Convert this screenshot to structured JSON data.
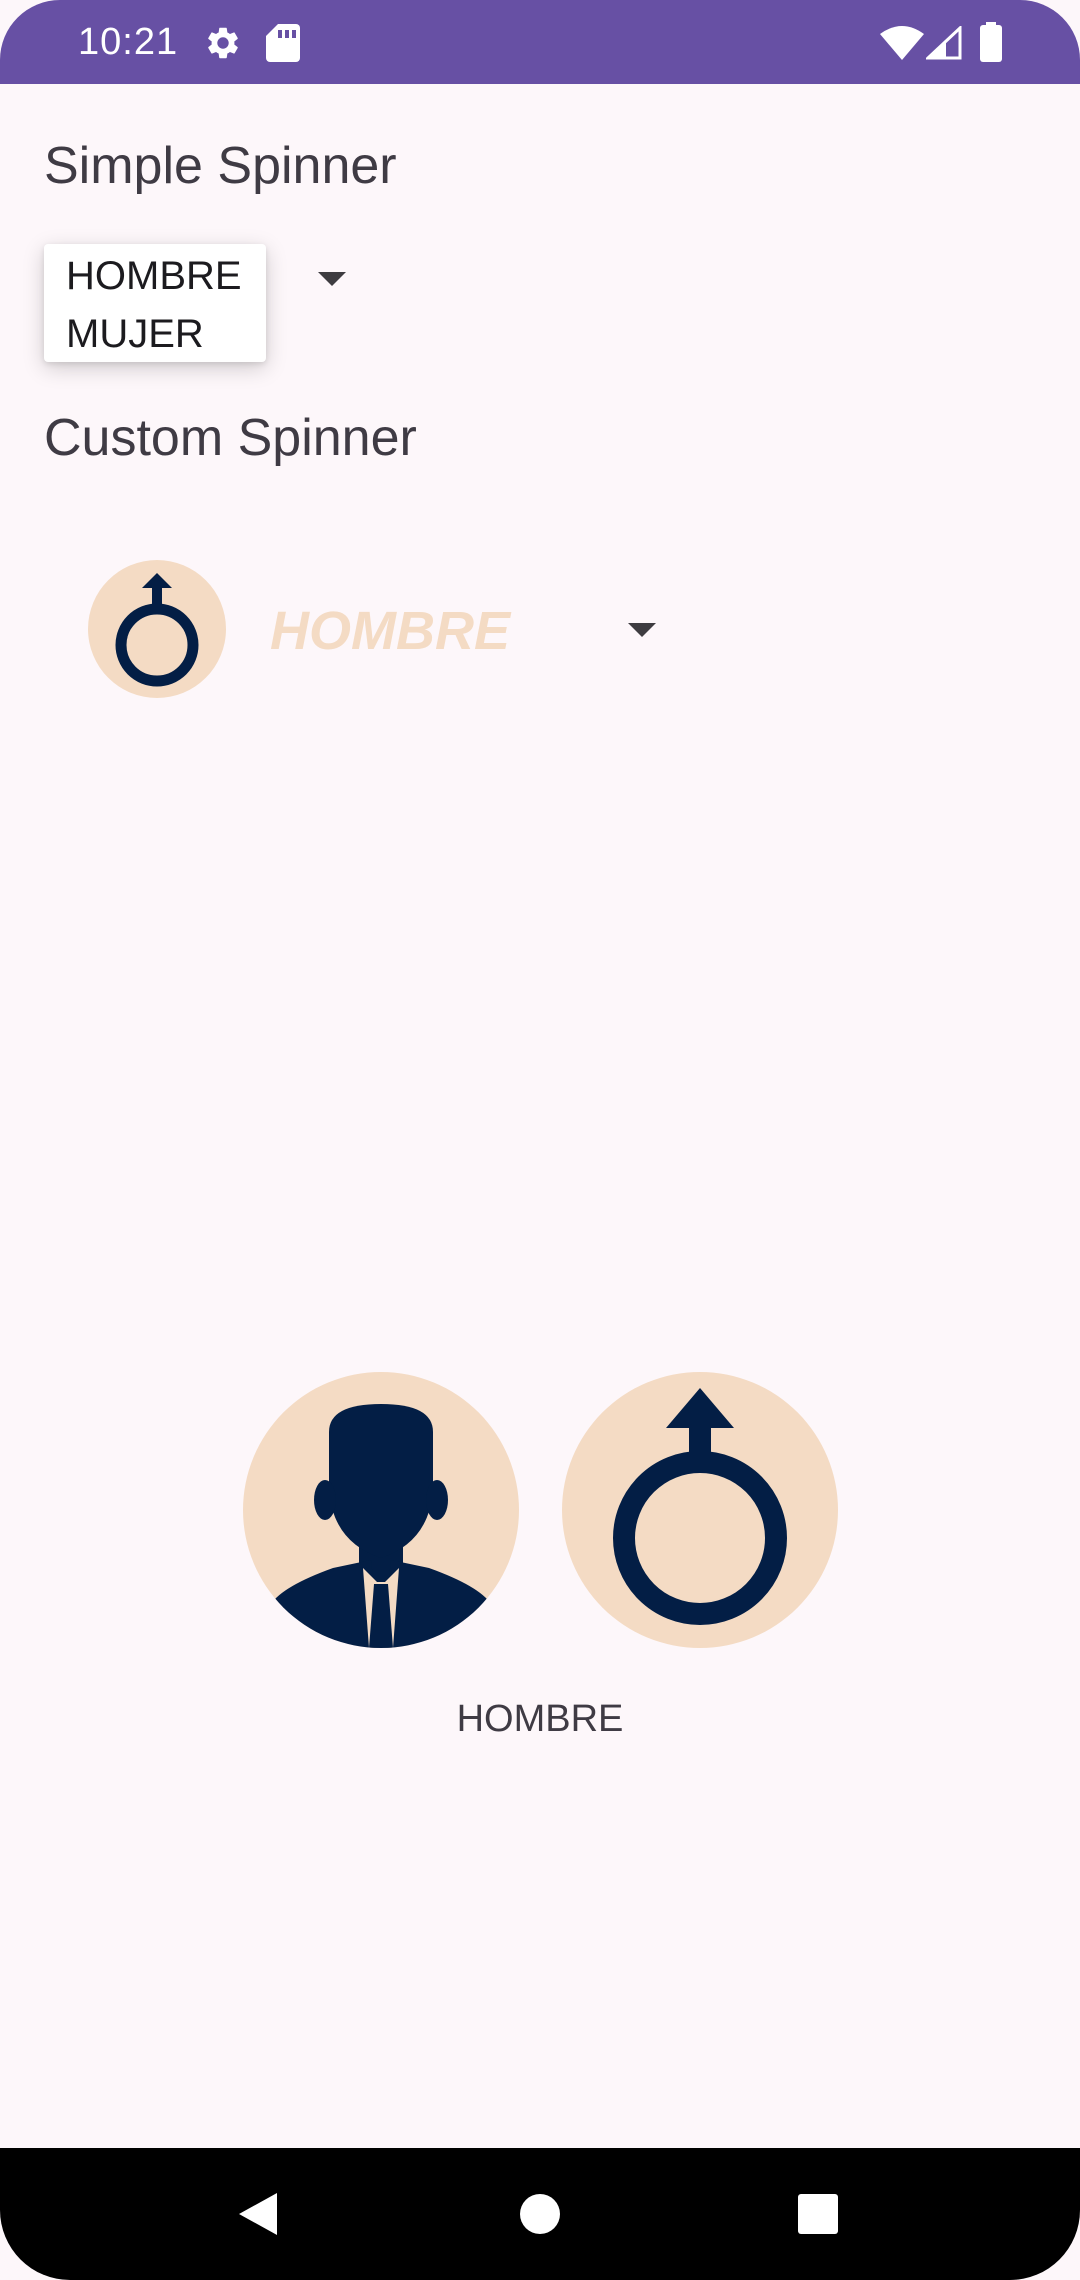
{
  "status_bar": {
    "time": "10:21",
    "left_icons": [
      "gear-icon",
      "sd-card-icon"
    ],
    "right_icons": [
      "wifi-icon",
      "signal-icon",
      "battery-icon"
    ],
    "background": "#6750a4"
  },
  "simple_spinner": {
    "title": "Simple Spinner",
    "options": [
      "HOMBRE",
      "MUJER"
    ]
  },
  "custom_spinner": {
    "title": "Custom Spinner",
    "selected_label": "HOMBRE",
    "selected_icon": "male-symbol-icon",
    "label_color": "#f4dbc4"
  },
  "result": {
    "images": [
      "man-avatar-icon",
      "male-symbol-icon"
    ],
    "label": "HOMBRE"
  },
  "nav_bar": {
    "buttons": [
      "back-icon",
      "home-icon",
      "recents-icon"
    ]
  },
  "colors": {
    "accent": "#6750a4",
    "circle": "#f4dbc4",
    "icon_dark": "#031e45",
    "background": "#fdf7fa"
  }
}
